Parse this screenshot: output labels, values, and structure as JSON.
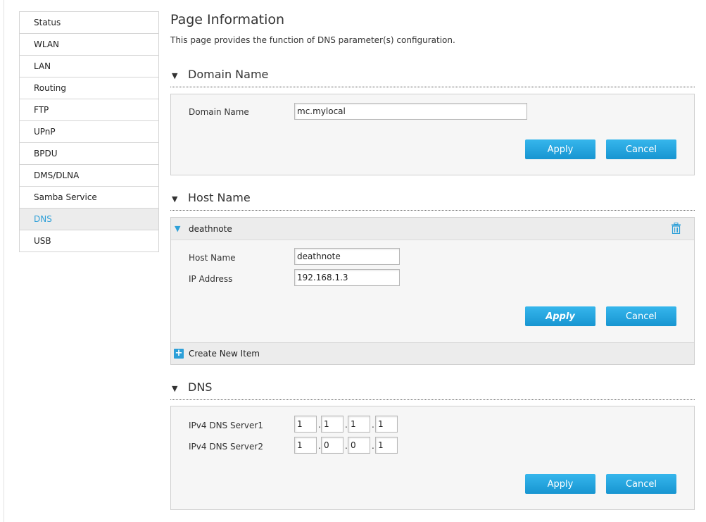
{
  "sidebar": {
    "items": [
      {
        "label": "Status"
      },
      {
        "label": "WLAN"
      },
      {
        "label": "LAN"
      },
      {
        "label": "Routing"
      },
      {
        "label": "FTP"
      },
      {
        "label": "UPnP"
      },
      {
        "label": "BPDU"
      },
      {
        "label": "DMS/DLNA"
      },
      {
        "label": "Samba Service"
      },
      {
        "label": "DNS",
        "active": true
      },
      {
        "label": "USB"
      }
    ]
  },
  "page": {
    "title": "Page Information",
    "description": "This page provides the function of DNS parameter(s) configuration."
  },
  "domain": {
    "heading": "Domain Name",
    "field_label": "Domain Name",
    "value": "mc.mylocal",
    "apply_label": "Apply",
    "cancel_label": "Cancel"
  },
  "host": {
    "heading": "Host Name",
    "entry_name": "deathnote",
    "host_label": "Host Name",
    "host_value": "deathnote",
    "ip_label": "IP Address",
    "ip_value": "192.168.1.3",
    "apply_label": "Apply",
    "cancel_label": "Cancel",
    "create_label": "Create New Item"
  },
  "dns": {
    "heading": "DNS",
    "server1_label": "IPv4 DNS Server1",
    "server1": [
      "1",
      "1",
      "1",
      "1"
    ],
    "server2_label": "IPv4 DNS Server2",
    "server2": [
      "1",
      "0",
      "0",
      "1"
    ],
    "apply_label": "Apply",
    "cancel_label": "Cancel"
  },
  "colors": {
    "accent": "#2ea0d8",
    "button": "#1e9ed9"
  }
}
